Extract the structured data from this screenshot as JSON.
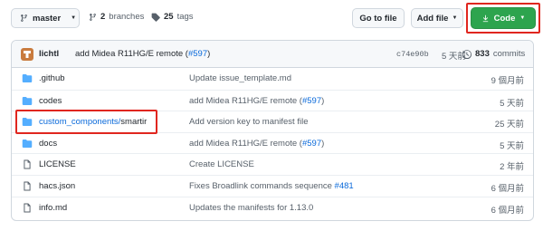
{
  "toolbar": {
    "branch": {
      "icon": "git-branch-icon",
      "label": "master"
    },
    "branches": {
      "icon": "git-branch-icon",
      "count": "2",
      "label": "branches"
    },
    "tags": {
      "icon": "tag-icon",
      "count": "25",
      "label": "tags"
    },
    "goto_file_label": "Go to file",
    "add_file_label": "Add file",
    "code": {
      "icon": "download-icon",
      "label": "Code"
    }
  },
  "colors": {
    "code_button": "#2da44e",
    "highlight": "#e0261f",
    "link": "#0969da",
    "folder": "#54aeff"
  },
  "commit": {
    "author": "lichtl",
    "message": "add Midea R11HG/E remote (",
    "pr": "#597",
    "message_end": ")",
    "sha": "c74e90b",
    "time": "5 天前",
    "count": "833",
    "count_label": "commits"
  },
  "files": [
    {
      "type": "folder",
      "name": ".github",
      "message": "Update issue_template.md",
      "time": "9 個月前"
    },
    {
      "type": "folder",
      "name": "codes",
      "message": "add Midea R11HG/E remote (",
      "pr": "#597",
      "message_end": ")",
      "time": "5 天前"
    },
    {
      "type": "folder",
      "name_prefix": "custom_components/",
      "name": "smartir",
      "message": "Add version key to manifest file",
      "time": "25 天前"
    },
    {
      "type": "folder",
      "name": "docs",
      "message": "add Midea R11HG/E remote (",
      "pr": "#597",
      "message_end": ")",
      "time": "5 天前"
    },
    {
      "type": "file",
      "name": "LICENSE",
      "message": "Create LICENSE",
      "time": "2 年前"
    },
    {
      "type": "file",
      "name": "hacs.json",
      "message": "Fixes Broadlink commands sequence ",
      "pr": "#481",
      "time": "6 個月前"
    },
    {
      "type": "file",
      "name": "info.md",
      "message": "Updates the manifests for 1.13.0",
      "time": "6 個月前"
    }
  ]
}
